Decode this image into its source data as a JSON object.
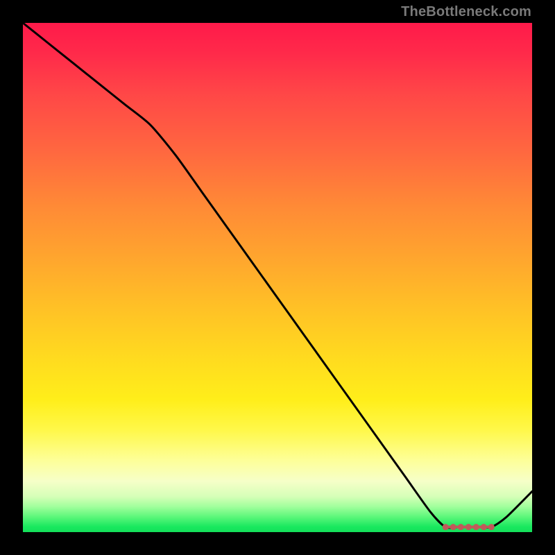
{
  "attribution": "TheBottleneck.com",
  "chart_data": {
    "type": "line",
    "title": "",
    "xlabel": "",
    "ylabel": "",
    "xlim": [
      0,
      100
    ],
    "ylim": [
      0,
      100
    ],
    "x": [
      0,
      5,
      10,
      15,
      20,
      25,
      30,
      35,
      40,
      45,
      50,
      55,
      60,
      65,
      70,
      75,
      80,
      83,
      86,
      89,
      92,
      95,
      100
    ],
    "values": [
      100,
      96,
      92,
      88,
      84,
      80,
      74,
      67,
      60,
      53,
      46,
      39,
      32,
      25,
      18,
      11,
      4,
      1,
      1,
      1,
      1,
      3,
      8
    ],
    "markers_x": [
      83,
      84.5,
      86,
      87.5,
      89,
      90.5,
      92
    ],
    "markers_y": [
      1,
      1,
      1,
      1,
      1,
      1,
      1
    ],
    "line_color": "#000000",
    "marker_color": "#c05a5a"
  }
}
